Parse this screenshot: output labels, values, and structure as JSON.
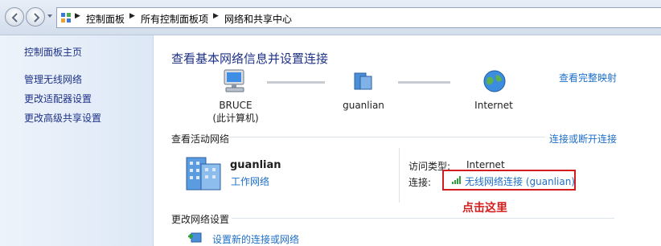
{
  "breadcrumb": {
    "items": [
      "控制面板",
      "所有控制面板项",
      "网络和共享中心"
    ]
  },
  "sidebar": {
    "items": [
      {
        "label": "控制面板主页"
      },
      {
        "label": "管理无线网络"
      },
      {
        "label": "更改适配器设置"
      },
      {
        "label": "更改高级共享设置"
      }
    ]
  },
  "main": {
    "title": "查看基本网络信息并设置连接",
    "full_map_link": "查看完整映射",
    "network_map": {
      "computer_name": "BRUCE",
      "computer_sub": "(此计算机)",
      "network_name": "guanlian",
      "internet_label": "Internet"
    },
    "active_networks": {
      "heading": "查看活动网络",
      "connect_link": "连接或断开连接",
      "network_name": "guanlian",
      "network_type": "工作网络",
      "access_type_label": "访问类型:",
      "access_type_value": "Internet",
      "connections_label": "连接:",
      "connection_link": "无线网络连接 (guanlian)"
    },
    "annotation": "点击这里",
    "change_settings": {
      "heading": "更改网络设置",
      "setup_link": "设置新的连接或网络"
    }
  },
  "colors": {
    "link": "#1e6fc9",
    "title": "#1e3287",
    "annotation_red": "#d31c1c"
  }
}
